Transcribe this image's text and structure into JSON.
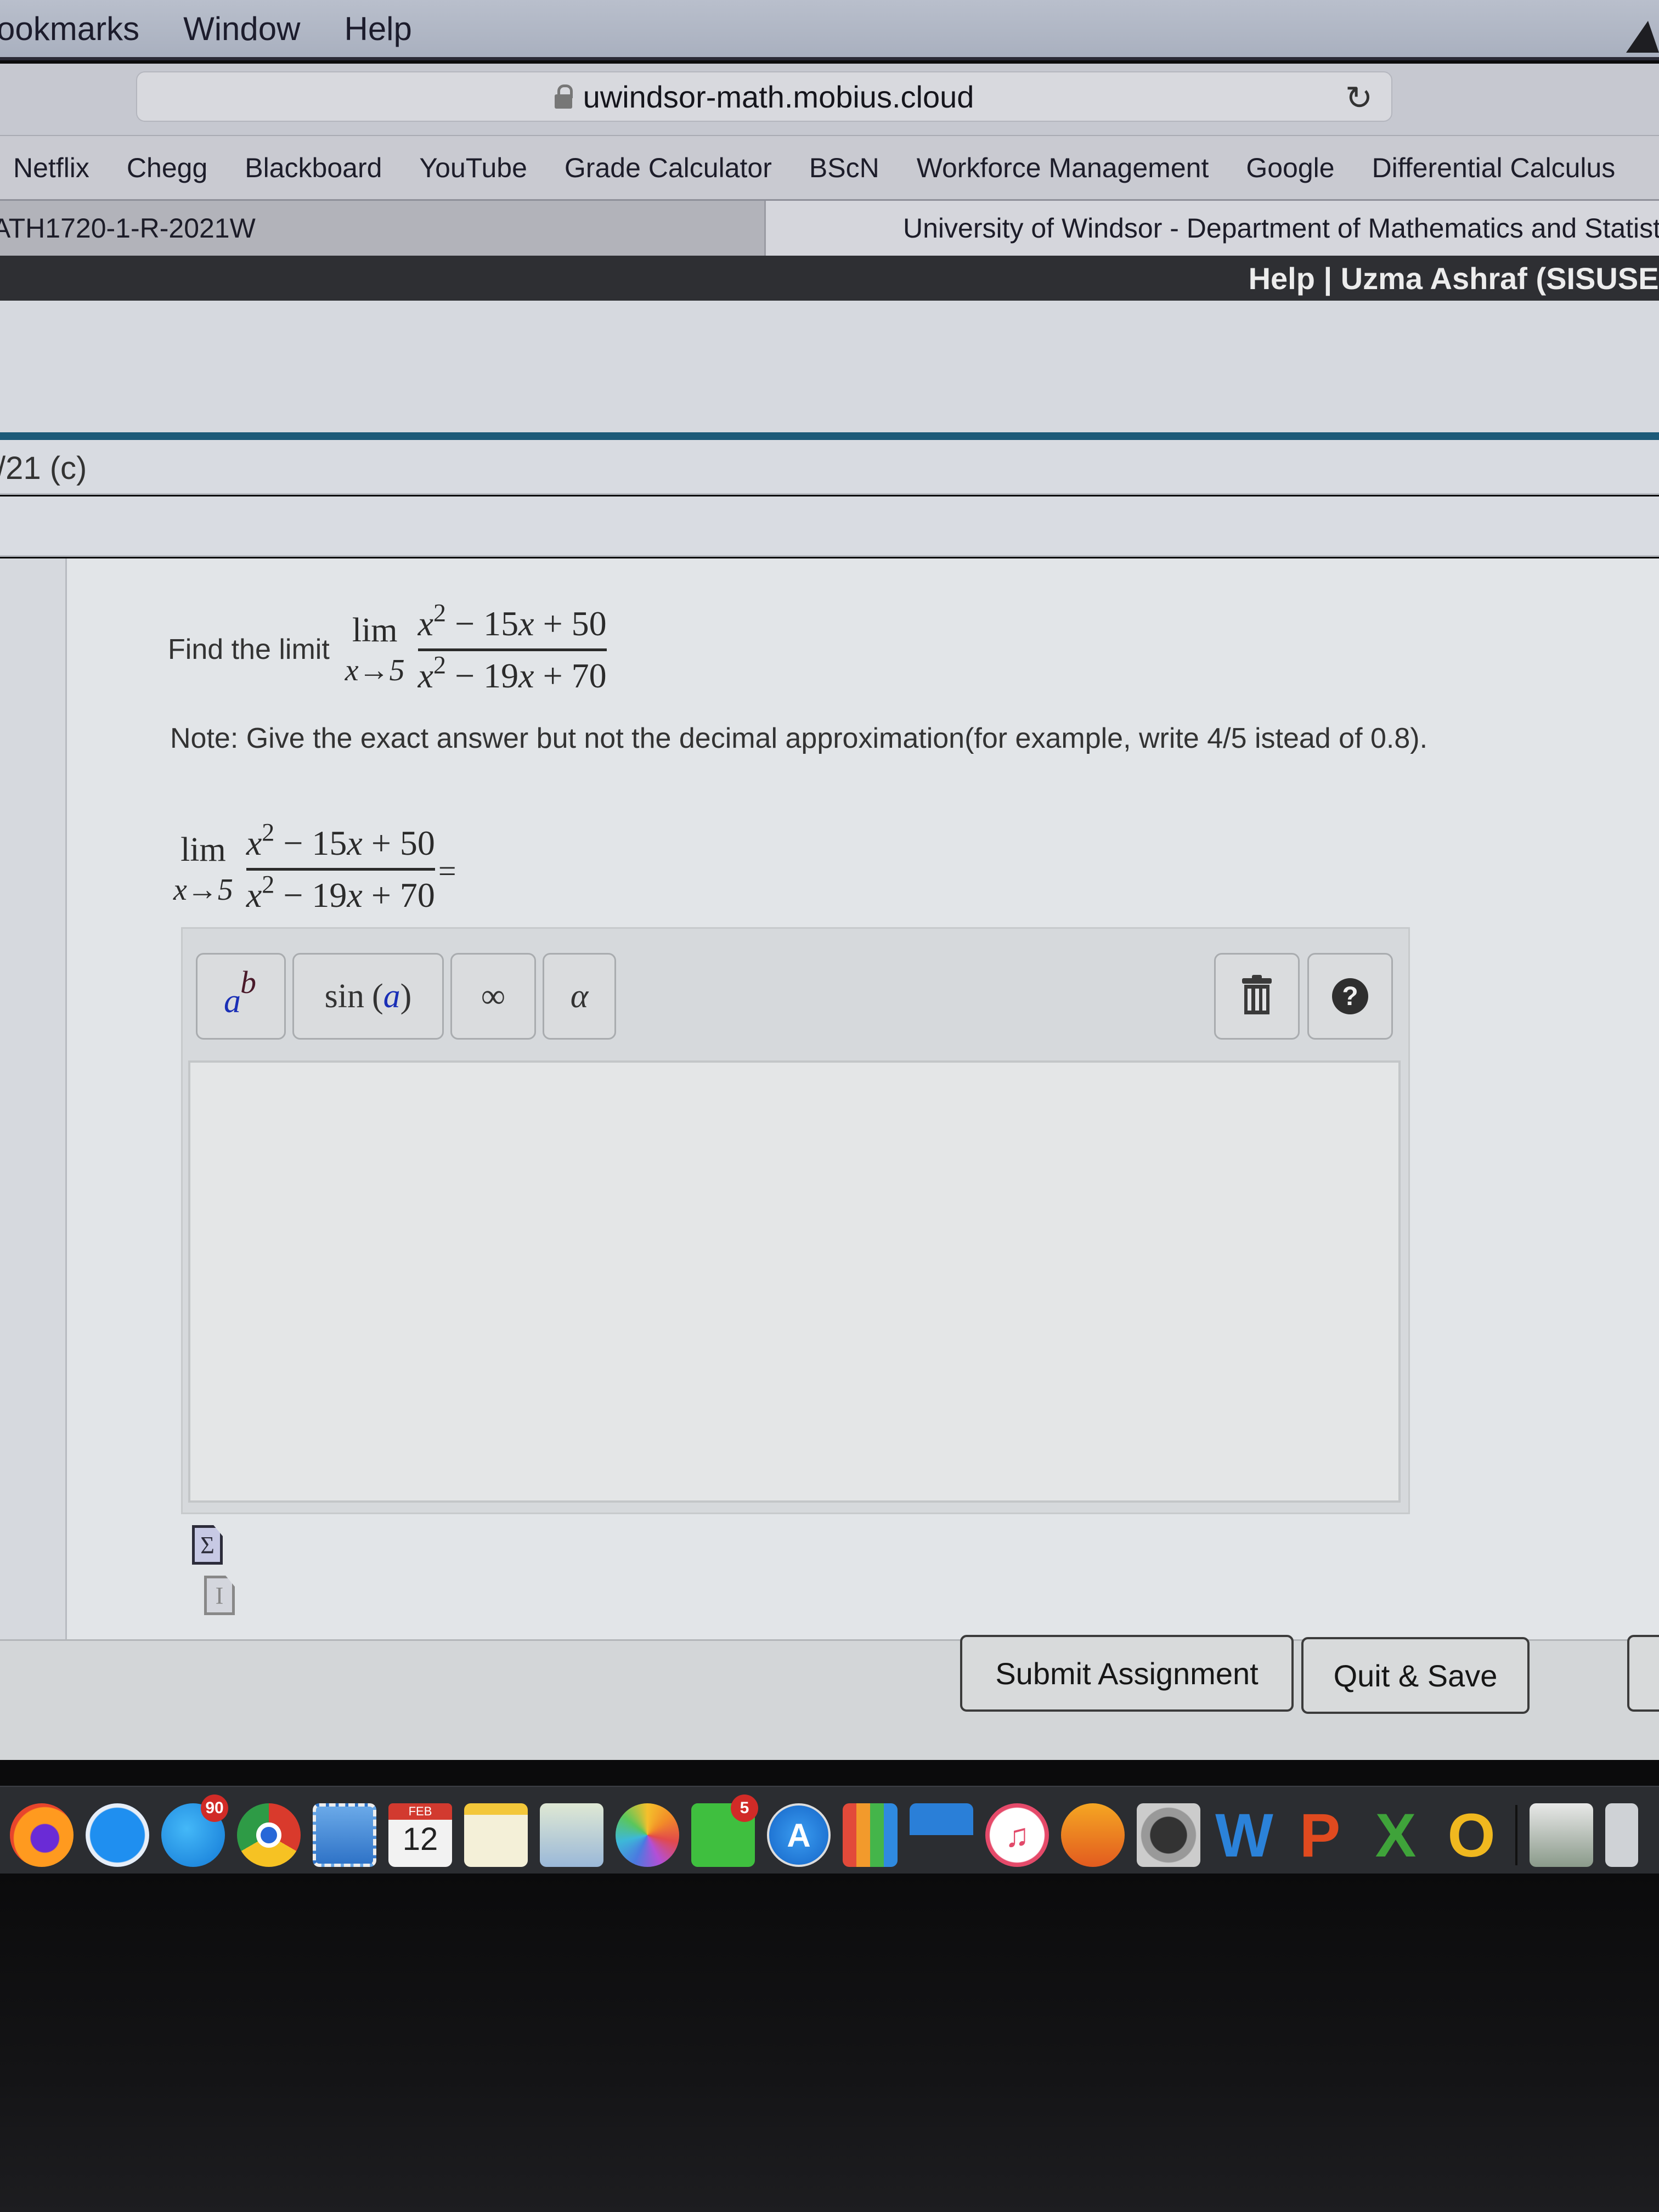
{
  "menubar": {
    "items": [
      "ookmarks",
      "Window",
      "Help"
    ]
  },
  "browser": {
    "url": "uwindsor-math.mobius.cloud",
    "lock_icon": "lock-icon",
    "reload_icon": "reload-icon",
    "reload_glyph": "↻"
  },
  "bookmarks": [
    "Netflix",
    "Chegg",
    "Blackboard",
    "YouTube",
    "Grade Calculator",
    "BScN",
    "Workforce Management",
    "Google",
    "Differential Calculus"
  ],
  "tabs": [
    {
      "label": "ATH1720-1-R-2021W",
      "active": false
    },
    {
      "label": "University of Windsor - Department of Mathematics and Statistics",
      "active": true
    }
  ],
  "site_header": {
    "user_links": "Help | Uzma Ashraf (SISUSER"
  },
  "question": {
    "number_label": "/21 (c)",
    "prompt": "Find the limit",
    "limit": {
      "word": "lim",
      "approach": "x→5",
      "numerator": [
        "x",
        "2",
        " − 15",
        "x",
        " + 50"
      ],
      "denominator": [
        "x",
        "2",
        " − 19",
        "x",
        " + 70"
      ]
    },
    "note": "Note: Give the exact answer but not the decimal approximation(for example, write 4/5 istead of 0.8).",
    "equals": "="
  },
  "editor": {
    "palette": {
      "power": {
        "base": "a",
        "exponent": "b"
      },
      "sin": {
        "fn": "sin",
        "open": "(",
        "arg": "a",
        "close": ")"
      },
      "infinity": "∞",
      "alpha": "α",
      "help": "?"
    },
    "answer_value": ""
  },
  "actions": {
    "submit": "Submit Assignment",
    "quit_save": "Quit & Save"
  },
  "dock": {
    "messages_badge": "90",
    "facetime_badge": "5",
    "calendar_month": "FEB",
    "calendar_day": "12",
    "word_letter": "W",
    "powerpoint_letter": "P",
    "excel_letter": "X",
    "outlook_letter": "O"
  }
}
